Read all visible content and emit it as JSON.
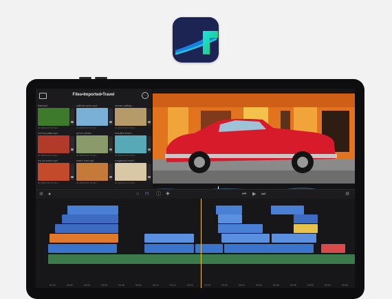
{
  "app": {
    "icon_name": "lumafusion-app-icon",
    "brand_bg": "#1b2452"
  },
  "browser": {
    "title": "Files•Imported•Travel",
    "clips": [
      {
        "name": "flats.mp4",
        "meta": "4k 3840x2160 30.0fps",
        "thumb": "#3d7a2c"
      },
      {
        "name": "sailboat scene.mp4",
        "meta": "4k 3840x2160 30.0fps",
        "thumb": "#7ab0d6"
      },
      {
        "name": "woman walking ...",
        "meta": "4k 3840x2160 30.0fps",
        "thumb": "#b59a6a"
      },
      {
        "name": "hot food plate.mp4",
        "meta": "4k 3840x2160 30.0fps",
        "thumb": "#b23a2a"
      },
      {
        "name": "girl sit outside...",
        "meta": "4k 3840x2160 30.0fps",
        "thumb": "#8a9a6a"
      },
      {
        "name": "beautiful beach...",
        "meta": "4k 3840x2160 30.0fps",
        "thumb": "#58a9b8"
      },
      {
        "name": "red car scene.mp4",
        "meta": "4k 3840x2160 30.0fps",
        "thumb": "#c34a2a"
      },
      {
        "name": "desert road.mp4",
        "meta": "4k 3840x2160 30.0fps",
        "thumb": "#c67a3a"
      },
      {
        "name": "sunglasses beach...",
        "meta": "4k 3840x2160 30.0fps",
        "thumb": "#d9c8a6"
      }
    ]
  },
  "toolbar": {
    "icons": [
      "undo-icon",
      "record-icon",
      "search-icon",
      "magnet-icon",
      "info-icon",
      "add-icon",
      "skip-back-icon",
      "play-icon",
      "skip-forward-icon",
      "settings-icon"
    ]
  },
  "timeline": {
    "ruler": [
      "00:00",
      "00:02",
      "00:04",
      "00:06",
      "00:08",
      "00:10",
      "00:12",
      "00:14",
      "00:16",
      "00:18",
      "00:20",
      "00:22",
      "00:24",
      "00:26",
      "00:28",
      "00:30",
      "00:32",
      "00:34"
    ],
    "colors": {
      "video": "#4a7fd6",
      "title": "#3e6bc2",
      "orange": "#e07a2a",
      "yellow": "#e8c34a",
      "red": "#d94a4a",
      "audio": "#3b7a4a",
      "clip_blue": "#5b8fe0"
    }
  }
}
